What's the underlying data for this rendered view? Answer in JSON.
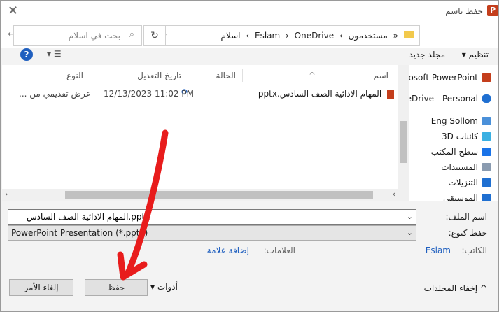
{
  "window": {
    "title": "حفظ باسم",
    "app_icon_letter": "P"
  },
  "address": {
    "crumbs": [
      "«",
      "مستخدمون",
      "›",
      "Eslam",
      "›",
      "OneDrive",
      "›",
      "اسلام"
    ],
    "search_placeholder": "بحث في اسلام"
  },
  "toolbar": {
    "organize_label": "تنظيم ▾",
    "new_folder_label": "مجلد جديد",
    "help_label": "?"
  },
  "nav": {
    "items": [
      {
        "label": "crosoft PowerPoint",
        "icon": "powerpoint-icon",
        "color": "#c43e1c"
      },
      {
        "label": "neDrive - Personal",
        "icon": "onedrive-icon",
        "color": "#1f6fd1"
      },
      {
        "label": "Eng Sollom",
        "icon": "pc-icon",
        "color": "#4a90d9"
      },
      {
        "label": "كائنات 3D",
        "icon": "cube-icon",
        "color": "#3ab0e2"
      },
      {
        "label": "سطح المكتب",
        "icon": "desktop-icon",
        "color": "#1a73e8"
      },
      {
        "label": "المستندات",
        "icon": "documents-icon",
        "color": "#8a9bb0"
      },
      {
        "label": "التنزيلات",
        "icon": "download-icon",
        "color": "#1f6fd1"
      },
      {
        "label": "الموسيقى",
        "icon": "music-icon",
        "color": "#1f6fd1"
      }
    ]
  },
  "columns": {
    "name": "اسم",
    "status": "الحالة",
    "modified": "تاريخ التعديل",
    "type": "النوع"
  },
  "files": [
    {
      "name": "المهام الادائية الصف السادس.pptx",
      "modified": "12/13/2023 11:02 PM",
      "type": "عرض تقديمي من ..."
    }
  ],
  "form": {
    "filename_label": "اسم الملف:",
    "filename_value": "المهام الادائية الصف السادس.pptx",
    "savetype_label": "حفظ كنوع:",
    "savetype_value": "PowerPoint Presentation (*.pptx)",
    "author_label": "الكاتب:",
    "author_value": "Eslam",
    "tags_label": "العلامات:",
    "tags_value": "إضافة علامة"
  },
  "buttons": {
    "tools": "أدوات",
    "save": "حفظ",
    "cancel": "إلغاء الأمر",
    "hide_folders": "إخفاء المجلدات"
  },
  "colors": {
    "link": "#1f5fbf",
    "annotation_arrow": "#e81c1c"
  }
}
